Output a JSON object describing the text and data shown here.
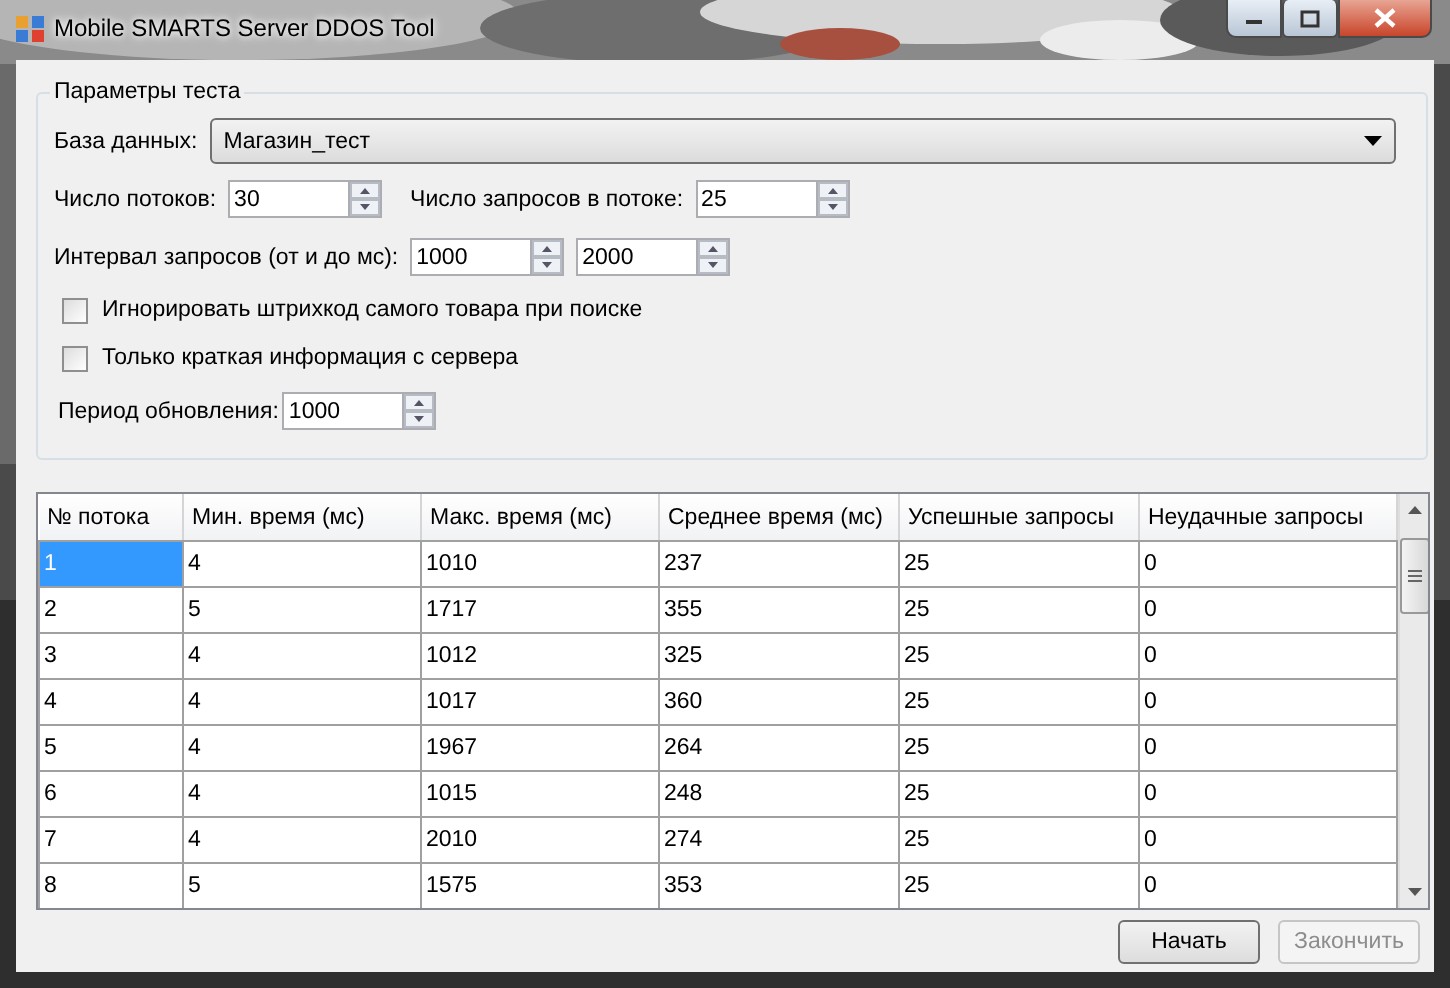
{
  "window": {
    "title": "Mobile SMARTS Server DDOS Tool"
  },
  "settings": {
    "title": "Параметры теста",
    "database": {
      "label": "База данных:",
      "value": "Магазин_тест"
    },
    "threads": {
      "label": "Число потоков:",
      "value": "30"
    },
    "requests_per_thread": {
      "label": "Число запросов в потоке:",
      "value": "25"
    },
    "interval": {
      "label": "Интервал запросов (от и до мс):",
      "from": "1000",
      "to": "2000"
    },
    "options": [
      {
        "label": "Игнорировать штрихкод самого товара при поиске",
        "checked": false
      },
      {
        "label": "Только краткая информация с сервера",
        "checked": false
      }
    ],
    "refresh": {
      "label": "Период обновления:",
      "value": "1000"
    }
  },
  "table": {
    "columns": [
      "№ потока",
      "Мин. время (мс)",
      "Макс. время  (мс)",
      "Среднее время  (мс)",
      "Успешные запросы",
      "Неудачные запросы"
    ],
    "rows": [
      {
        "selected": true,
        "cells": [
          "1",
          "4",
          "1010",
          "237",
          "25",
          "0"
        ]
      },
      {
        "selected": false,
        "cells": [
          "2",
          "5",
          "1717",
          "355",
          "25",
          "0"
        ]
      },
      {
        "selected": false,
        "cells": [
          "3",
          "4",
          "1012",
          "325",
          "25",
          "0"
        ]
      },
      {
        "selected": false,
        "cells": [
          "4",
          "4",
          "1017",
          "360",
          "25",
          "0"
        ]
      },
      {
        "selected": false,
        "cells": [
          "5",
          "4",
          "1967",
          "264",
          "25",
          "0"
        ]
      },
      {
        "selected": false,
        "cells": [
          "6",
          "4",
          "1015",
          "248",
          "25",
          "0"
        ]
      },
      {
        "selected": false,
        "cells": [
          "7",
          "4",
          "2010",
          "274",
          "25",
          "0"
        ]
      },
      {
        "selected": false,
        "cells": [
          "8",
          "5",
          "1575",
          "353",
          "25",
          "0"
        ]
      }
    ]
  },
  "buttons": [
    {
      "label": "Начать",
      "disabled": false
    },
    {
      "label": "Закончить",
      "disabled": true
    }
  ]
}
